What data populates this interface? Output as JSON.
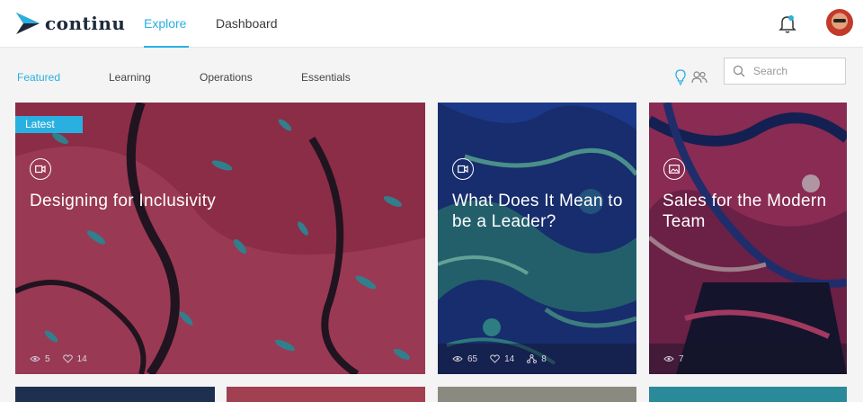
{
  "app": {
    "logo_text": "continu"
  },
  "nav": {
    "tabs": [
      {
        "label": "Explore",
        "active": true
      },
      {
        "label": "Dashboard",
        "active": false
      }
    ]
  },
  "subnav": {
    "items": [
      {
        "label": "Featured",
        "active": true
      },
      {
        "label": "Learning"
      },
      {
        "label": "Operations"
      },
      {
        "label": "Essentials"
      }
    ]
  },
  "search": {
    "placeholder": "Search",
    "value": ""
  },
  "colors": {
    "accent": "#2ab0e0",
    "topbar": "#ffffff",
    "page": "#f4f4f4"
  },
  "cards": [
    {
      "badge": "Latest",
      "title": "Designing for Inclusivity",
      "type_icon": "video-icon",
      "stats": {
        "views": "5",
        "likes": "14"
      }
    },
    {
      "title": "What Does It Mean to be a Leader?",
      "type_icon": "video-icon",
      "stats": {
        "views": "65",
        "likes": "14",
        "shares": "8"
      }
    },
    {
      "title": "Sales for the Modern Team",
      "type_icon": "image-icon",
      "stats": {
        "views": "7"
      }
    }
  ]
}
